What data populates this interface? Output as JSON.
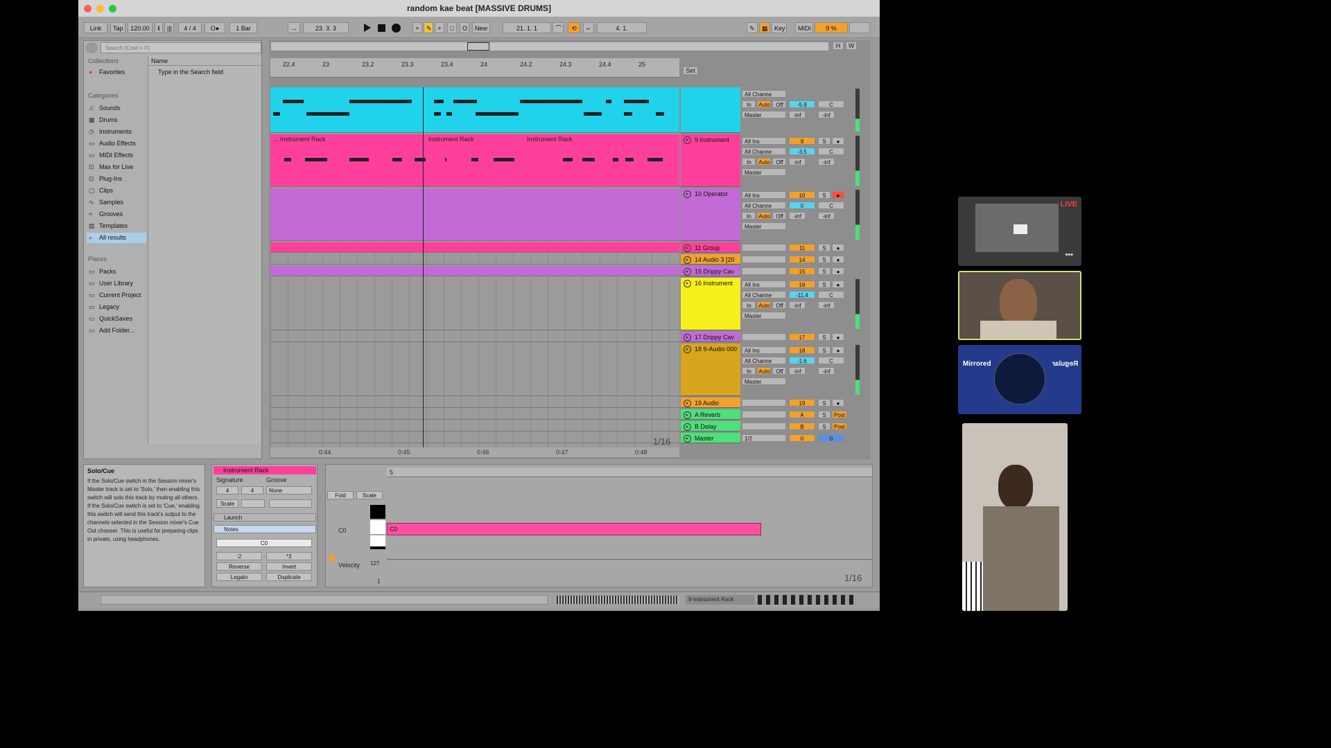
{
  "window": {
    "title": "random kae beat  [MASSIVE DRUMS]"
  },
  "transport": {
    "link": "Link",
    "tap": "Tap",
    "tempo": "120.00",
    "signature": "4 / 4",
    "quantize": "1 Bar",
    "position": "23.   3.   3",
    "new": "New",
    "loop_start": "21.   1.   1",
    "loop_length": "4.   1.",
    "key": "Key",
    "midi": "MIDI",
    "cpu": "9 %"
  },
  "browser": {
    "search_placeholder": "Search (Cmd + F)",
    "collections_header": "Collections",
    "favorites": "Favorites",
    "categories_header": "Categories",
    "categories": [
      "Sounds",
      "Drums",
      "Instruments",
      "Audio Effects",
      "MIDI Effects",
      "Max for Live",
      "Plug-Ins",
      "Clips",
      "Samples",
      "Grooves",
      "Templates",
      "All results"
    ],
    "places_header": "Places",
    "places": [
      "Packs",
      "User Library",
      "Current Project",
      "Legacy",
      "QuickSaves",
      "Add Folder..."
    ],
    "name_header": "Name",
    "name_hint": "Type in the Search field"
  },
  "arrangement": {
    "ruler": [
      "22.4",
      "23",
      "23.2",
      "23.3",
      "23.4",
      "24",
      "24.2",
      "24.3",
      "24.4",
      "25"
    ],
    "times": [
      "0:44",
      "0:45",
      "0:46",
      "0:47",
      "0:48"
    ],
    "grid": "1/16",
    "set_label": "Set",
    "clip_names": [
      "... Instrument Rack",
      "Instrument Rack",
      "Instrument Rack"
    ]
  },
  "tracks": [
    {
      "name": "",
      "input": "All Channe",
      "mon_in": "In",
      "mon_auto": "Auto",
      "mon_off": "Off",
      "output": "Master",
      "num": "",
      "vol": "-5.9",
      "pan": "C",
      "peak1": "-inf",
      "peak2": "-inf"
    },
    {
      "name": "9 Instrument",
      "input_type": "All Ins",
      "input": "All Channe",
      "mon_in": "In",
      "mon_auto": "Auto",
      "mon_off": "Off",
      "output": "Master",
      "num": "9",
      "vol": "-3.5",
      "pan": "C",
      "peak1": "-inf",
      "peak2": "-inf"
    },
    {
      "name": "10 Operator",
      "input_type": "All Ins",
      "input": "All Channe",
      "mon_in": "In",
      "mon_auto": "Auto",
      "mon_off": "Off",
      "output": "Master",
      "num": "10",
      "vol": "0",
      "pan": "C",
      "peak1": "-inf",
      "peak2": "-inf"
    },
    {
      "name": "11 Group",
      "num": "11"
    },
    {
      "name": "14 Audio 3 [20",
      "num": "14"
    },
    {
      "name": "15 Drippy Cav",
      "num": "15"
    },
    {
      "name": "16 Instrument",
      "input_type": "All Ins",
      "input": "All Channe",
      "mon_in": "In",
      "mon_auto": "Auto",
      "mon_off": "Off",
      "output": "Master",
      "num": "16",
      "vol": "-11.4",
      "pan": "C",
      "peak1": "-inf",
      "peak2": "-inf"
    },
    {
      "name": "17 Drippy Cav",
      "num": "17"
    },
    {
      "name": "18 9-Audio 000",
      "input_type": "All Ins",
      "input": "All Channe",
      "mon_in": "In",
      "mon_auto": "Auto",
      "mon_off": "Off",
      "output": "Master",
      "num": "18",
      "vol": "-1.6",
      "pan": "C",
      "peak1": "-inf",
      "peak2": "-inf"
    },
    {
      "name": "19 Audio",
      "num": "19"
    },
    {
      "name": "A Reverb",
      "num": "A",
      "post": "Post"
    },
    {
      "name": "B Delay",
      "num": "B",
      "post": "Post"
    },
    {
      "name": "Master",
      "output": "1/2",
      "num": "0",
      "pan": "0"
    }
  ],
  "mixer": {
    "solo": "S"
  },
  "info": {
    "title": "Solo/Cue",
    "text": "If the Solo/Cue switch in the Session mixer's Master track is set to 'Solo,' then enabling this switch will solo this track by muting all others. If the Solo/Cue switch is set to 'Cue,' enabling this switch will send this track's output to the channels selected in the Session mixer's Cue Out chooser. This is useful for preparing clips in private, using headphones."
  },
  "clip": {
    "name": "Instrument Rack",
    "signature_label": "Signature",
    "groove_label": "Groove",
    "sig_num": "4",
    "sig_den": "4",
    "groove": "None",
    "scale": "Scale",
    "launch": "Launch",
    "notes": "Notes",
    "note": "C0",
    "half": ":2",
    "double": "*2",
    "reverse": "Reverse",
    "invert": "Invert",
    "legato": "Legato",
    "duplicate": "Duplicate"
  },
  "editor": {
    "bar_label": "5",
    "fold": "Fold",
    "scale": "Scale",
    "key": "C0",
    "note": "C0",
    "velocity": "Velocity",
    "vel_max": "127",
    "vel_min": "1",
    "grid": "1/16"
  },
  "statusbar": {
    "track": "9-Instrument Rack"
  },
  "feeds": {
    "live": "LIVE",
    "mirrored": "Mirrored",
    "regular": "Regular"
  },
  "colors": {
    "cyan": "#20d3ea",
    "pink": "#ff3f9c",
    "violet": "#c46ad6",
    "yellow": "#f7ef1c",
    "mustard": "#d9a51c",
    "green": "#4ee07a",
    "orange": "#f2a12d"
  }
}
